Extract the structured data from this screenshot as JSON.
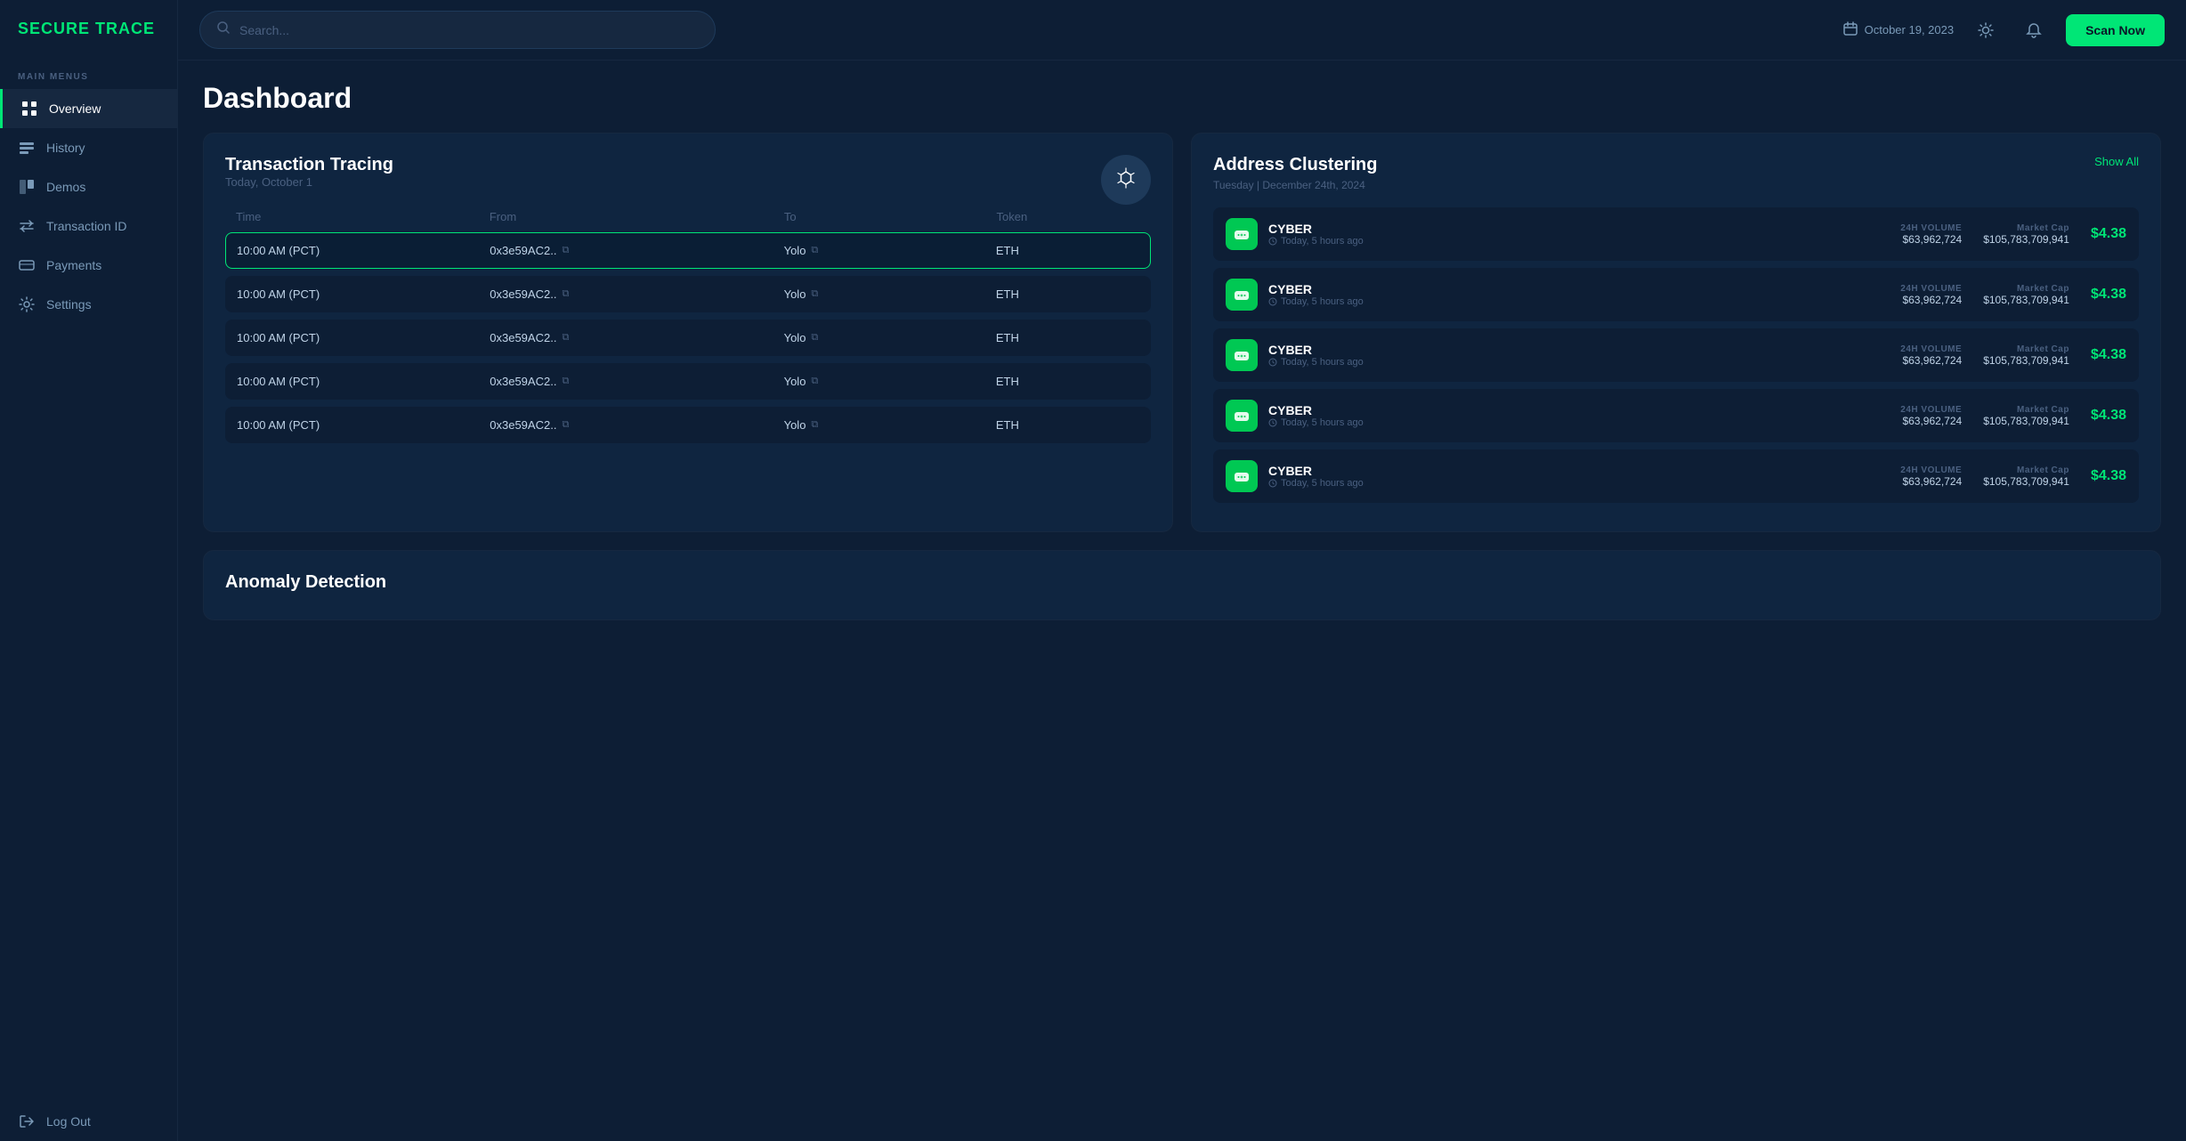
{
  "app": {
    "name": "SECURE TRACE"
  },
  "sidebar": {
    "section_label": "MAIN MENUS",
    "items": [
      {
        "id": "overview",
        "label": "Overview",
        "icon": "⊞",
        "active": true
      },
      {
        "id": "history",
        "label": "History",
        "icon": "▤",
        "active": false
      },
      {
        "id": "demos",
        "label": "Demos",
        "icon": "◫",
        "active": false
      },
      {
        "id": "transaction",
        "label": "Transaction ID",
        "icon": "⇄",
        "active": false
      },
      {
        "id": "payments",
        "label": "Payments",
        "icon": "▭",
        "active": false
      },
      {
        "id": "settings",
        "label": "Settings",
        "icon": "⚙",
        "active": false
      },
      {
        "id": "logout",
        "label": "Log Out",
        "icon": "⎋",
        "active": false
      }
    ]
  },
  "header": {
    "search_placeholder": "Search...",
    "date": "October 19, 2023",
    "scan_button_label": "Scan Now"
  },
  "page": {
    "title": "Dashboard"
  },
  "transaction_tracing": {
    "title": "Transaction Tracing",
    "subtitle": "Today, October 1",
    "columns": [
      "Time",
      "From",
      "To",
      "Token"
    ],
    "rows": [
      {
        "time": "10:00 AM (PCT)",
        "from": "0x3e59AC2..",
        "to": "Yolo",
        "token": "ETH",
        "active": true
      },
      {
        "time": "10:00 AM (PCT)",
        "from": "0x3e59AC2..",
        "to": "Yolo",
        "token": "ETH",
        "active": false
      },
      {
        "time": "10:00 AM (PCT)",
        "from": "0x3e59AC2..",
        "to": "Yolo",
        "token": "ETH",
        "active": false
      },
      {
        "time": "10:00 AM (PCT)",
        "from": "0x3e59AC2..",
        "to": "Yolo",
        "token": "ETH",
        "active": false
      },
      {
        "time": "10:00 AM (PCT)",
        "from": "0x3e59AC2..",
        "to": "Yolo",
        "token": "ETH",
        "active": false
      }
    ]
  },
  "address_clustering": {
    "title": "Address Clustering",
    "show_all_label": "Show All",
    "date": "Tuesday | December 24th, 2024",
    "items": [
      {
        "name": "CYBER",
        "time": "Today, 5 hours ago",
        "volume_label": "24H VOLUME",
        "volume_value": "$63,962,724",
        "market_cap_label": "Market Cap",
        "market_cap_value": "$105,783,709,941",
        "price": "$4.38"
      },
      {
        "name": "CYBER",
        "time": "Today, 5 hours ago",
        "volume_label": "24H VOLUME",
        "volume_value": "$63,962,724",
        "market_cap_label": "Market Cap",
        "market_cap_value": "$105,783,709,941",
        "price": "$4.38"
      },
      {
        "name": "CYBER",
        "time": "Today, 5 hours ago",
        "volume_label": "24H VOLUME",
        "volume_value": "$63,962,724",
        "market_cap_label": "Market Cap",
        "market_cap_value": "$105,783,709,941",
        "price": "$4.38"
      },
      {
        "name": "CYBER",
        "time": "Today, 5 hours ago",
        "volume_label": "24H VOLUME",
        "volume_value": "$63,962,724",
        "market_cap_label": "Market Cap",
        "market_cap_value": "$105,783,709,941",
        "price": "$4.38"
      },
      {
        "name": "CYBER",
        "time": "Today, 5 hours ago",
        "volume_label": "24H VOLUME",
        "volume_value": "$63,962,724",
        "market_cap_label": "Market Cap",
        "market_cap_value": "$105,783,709,941",
        "price": "$4.38"
      }
    ]
  },
  "anomaly_detection": {
    "title": "Anomaly Detection"
  }
}
